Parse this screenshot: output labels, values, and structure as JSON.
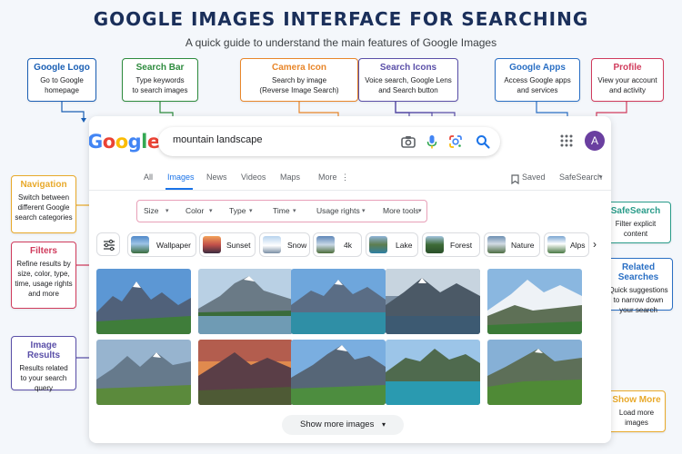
{
  "header": {
    "title": "GOOGLE IMAGES INTERFACE FOR SEARCHING",
    "subtitle": "A quick guide to understand the main features of Google Images"
  },
  "callouts": {
    "logo": {
      "title": "Google Logo",
      "desc": [
        "Go to Google",
        "homepage"
      ],
      "color": "#1a5fb4"
    },
    "searchbar": {
      "title": "Search Bar",
      "desc": [
        "Type keywords",
        "to search images"
      ],
      "color": "#2e8b3e"
    },
    "camera": {
      "title": "Camera Icon",
      "desc": [
        "Search by image",
        "(Reverse Image Search)"
      ],
      "color": "#e8862a"
    },
    "searchicons": {
      "title": "Search Icons",
      "desc": [
        "Voice search, Google Lens",
        "and Search button"
      ],
      "color": "#5a4fa8"
    },
    "apps": {
      "title": "Google Apps",
      "desc": [
        "Access Google apps",
        "and services"
      ],
      "color": "#2a6fc4"
    },
    "profile": {
      "title": "Profile",
      "desc": [
        "View your account",
        "and activity"
      ],
      "color": "#d03b5c"
    },
    "navigation": {
      "title": "Navigation",
      "desc": [
        "Switch between",
        "different Google",
        "search categories"
      ],
      "color": "#e8a92a"
    },
    "filters": {
      "title": "Filters",
      "desc": [
        "Refine results by",
        "size, color, type,",
        "time, usage rights",
        "and more"
      ],
      "color": "#d03b5c"
    },
    "results": {
      "title": "Image Results",
      "desc": [
        "Results related",
        "to your search",
        "query"
      ],
      "color": "#5a4fa8"
    },
    "safesearch": {
      "title": "SafeSearch",
      "desc": [
        "Filter explicit",
        "content"
      ],
      "color": "#2a9c8a"
    },
    "related": {
      "title": "Related Searches",
      "desc": [
        "Quick suggestions",
        "to narrow down",
        "your search"
      ],
      "color": "#2a6fc4"
    },
    "showmore": {
      "title": "Show More",
      "desc": [
        "Load more",
        "images"
      ],
      "color": "#e8a92a"
    }
  },
  "logo": {
    "letters": [
      "G",
      "o",
      "o",
      "g",
      "l",
      "e"
    ],
    "colors": [
      "#4285f4",
      "#ea4335",
      "#fbbc05",
      "#4285f4",
      "#34a853",
      "#ea4335"
    ]
  },
  "search": {
    "query": "mountain landscape"
  },
  "profile": {
    "initial": "A"
  },
  "nav": {
    "tabs": [
      "All",
      "Images",
      "News",
      "Videos",
      "Maps",
      "More"
    ],
    "active": "Images",
    "saved": "Saved",
    "safesearch": "SafeSearch"
  },
  "filters": [
    "Size",
    "Color",
    "Type",
    "Time",
    "Usage rights",
    "More tools"
  ],
  "related": [
    "Wallpaper",
    "Sunset",
    "Snow",
    "4k",
    "Lake",
    "Forest",
    "Nature",
    "Alps"
  ],
  "show_more": "Show more images"
}
